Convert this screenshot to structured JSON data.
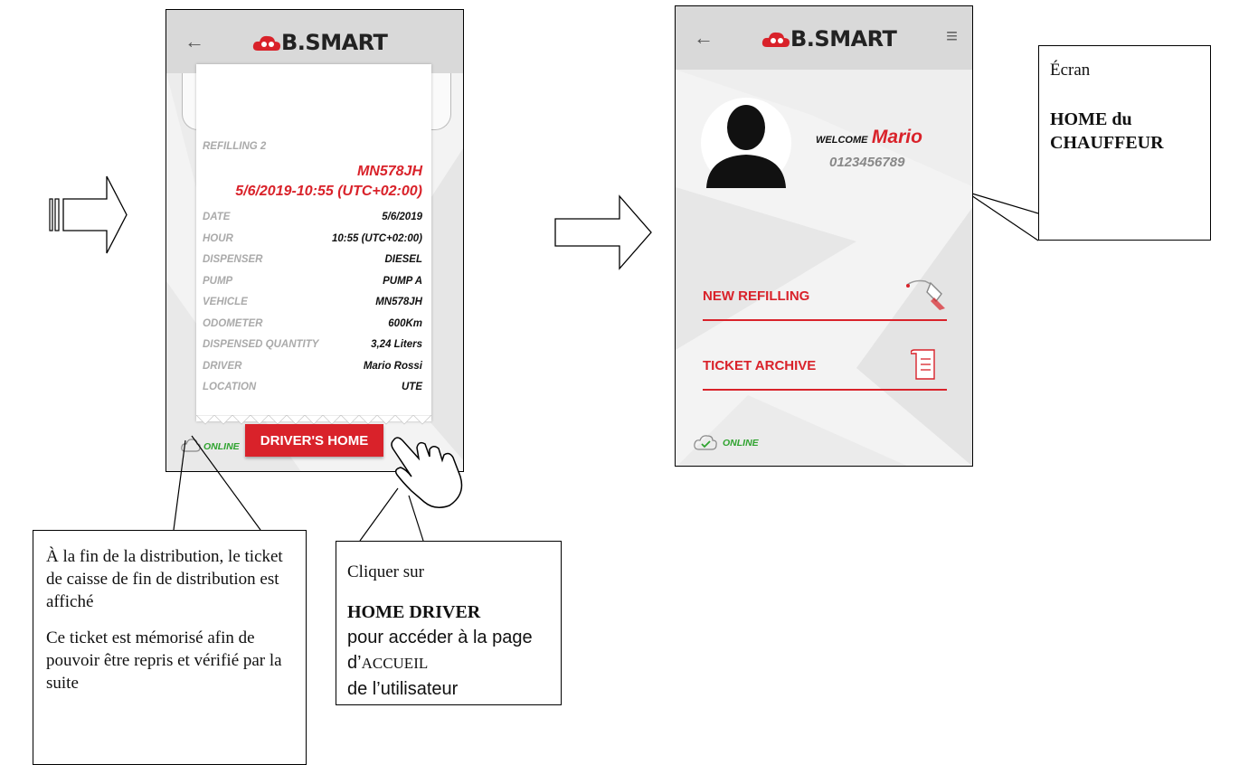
{
  "left_screen": {
    "brand": "B.SMART",
    "ticket": {
      "title": "REFILLING 2",
      "plate": "MN578JH",
      "datetime": "5/6/2019-10:55 (UTC+02:00)",
      "rows": [
        {
          "label": "DATE",
          "value": "5/6/2019"
        },
        {
          "label": "HOUR",
          "value": "10:55 (UTC+02:00)"
        },
        {
          "label": "DISPENSER",
          "value": "DIESEL"
        },
        {
          "label": "PUMP",
          "value": "PUMP A"
        },
        {
          "label": "VEHICLE",
          "value": "MN578JH"
        },
        {
          "label": "ODOMETER",
          "value": "600Km"
        },
        {
          "label": "DISPENSED QUANTITY",
          "value": "3,24 Liters"
        },
        {
          "label": "DRIVER",
          "value": "Mario Rossi"
        },
        {
          "label": "LOCATION",
          "value": "UTE"
        }
      ]
    },
    "status": "ONLINE",
    "driver_home_button": "DRIVER'S HOME"
  },
  "right_screen": {
    "brand": "B.SMART",
    "welcome_label": "WELCOME",
    "user_name": "Mario",
    "user_phone": "0123456789",
    "menu": [
      {
        "label": "NEW REFILLING",
        "icon": "fuel-nozzle-icon"
      },
      {
        "label": "TICKET ARCHIVE",
        "icon": "receipt-icon"
      }
    ],
    "status": "ONLINE"
  },
  "callouts": {
    "end_of_distribution": {
      "p1": "À la fin de la distribution, le ticket de caisse de fin de distribution est affiché",
      "p2": "Ce ticket est mémorisé afin de pouvoir être repris et vérifié par la suite"
    },
    "click": {
      "line1": "Cliquer sur",
      "bold": "HOME DRIVER",
      "rest1": "pour accéder à la page d’",
      "rest2": "ACCUEIL",
      "rest3": "de l’utilisateur"
    },
    "home_screen": {
      "line1": "Écran",
      "bold": "HOME du CHAUFFEUR"
    }
  },
  "colors": {
    "brand_red": "#d9222a",
    "online_green": "#2fa32f"
  }
}
